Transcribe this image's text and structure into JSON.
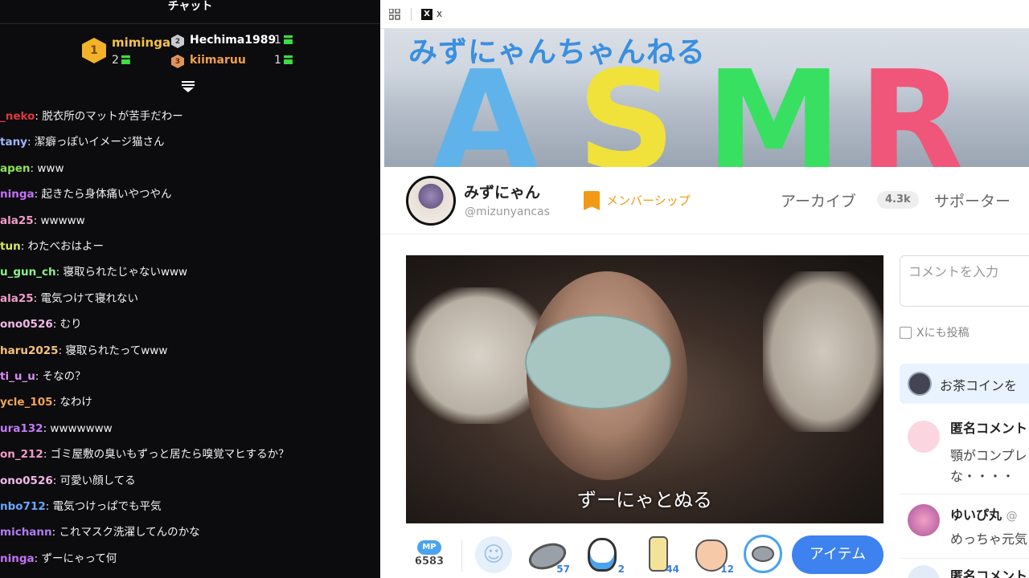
{
  "chat": {
    "title": "チャット",
    "ranking": [
      {
        "rank": "1",
        "name": "miminga",
        "count": "2",
        "name_color": "#f5c24a"
      },
      {
        "rank": "2",
        "name": "Hechima1989",
        "count": "1",
        "name_color": "#ffffff"
      },
      {
        "rank": "3",
        "name": "kiimaruu",
        "count": "1",
        "name_color": "#f0a04b"
      }
    ],
    "scroll_icon": "chevron-lines-down-icon",
    "messages": [
      {
        "user": "_neko",
        "text": "脱衣所のマットが苦手だわー",
        "color": "#e2363e"
      },
      {
        "user": "tany",
        "text": "潔癖っぽいイメージ猫さん",
        "color": "#9fb7ff"
      },
      {
        "user": "apen",
        "text": "www",
        "color": "#8ee25a"
      },
      {
        "user": "ninga",
        "text": "起きたら身体痛いやつやん",
        "color": "#c471f5"
      },
      {
        "user": "ala25",
        "text": "wwwww",
        "color": "#f29bc8"
      },
      {
        "user": "tun",
        "text": "わたべおはよー",
        "color": "#d6e85a"
      },
      {
        "user": "u_gun_ch",
        "text": "寝取られたじゃないwww",
        "color": "#8ef08a"
      },
      {
        "user": "ala25",
        "text": "電気つけて寝れない",
        "color": "#f29bc8"
      },
      {
        "user": "ono0526",
        "text": "むり",
        "color": "#f2b8e8"
      },
      {
        "user": "haru2025",
        "text": "寝取られたってwww",
        "color": "#f7c27a"
      },
      {
        "user": "ti_u_u",
        "text": "そなの？",
        "color": "#d98cf2"
      },
      {
        "user": "ycle_105",
        "text": "なわけ",
        "color": "#f2a45a"
      },
      {
        "user": "ura132",
        "text": "wwwwwww",
        "color": "#c27bf5"
      },
      {
        "user": "on_212",
        "text": "ゴミ屋敷の臭いもずっと居たら嗅覚マヒするか？",
        "color": "#f29bc8"
      },
      {
        "user": "ono0526",
        "text": "可愛い顔してる",
        "color": "#f2b8e8"
      },
      {
        "user": "nbo712",
        "text": "電気つけっぱでも平気",
        "color": "#6aa6ff"
      },
      {
        "user": "michann",
        "text": "これマスク洗濯してんのかな",
        "color": "#b07cf0"
      },
      {
        "user": "ninga",
        "text": "ずーにゃって何",
        "color": "#c471f5"
      }
    ]
  },
  "browser": {
    "apps_icon": "grid-icon",
    "tab_favicon": "x-logo-icon",
    "tab_label": "x"
  },
  "channel": {
    "banner_title": "みずにゃんちゃんねる",
    "banner_letters": "ASMR",
    "name": "みずにゃん",
    "handle": "@mizunyancas",
    "membership": "メンバーシップ",
    "archive": "アーカイブ",
    "archive_count": "4.3k",
    "supporter": "サポーター"
  },
  "video": {
    "caption": "ずーにゃとぬる"
  },
  "side": {
    "comment_placeholder": "コメントを入力",
    "x_share_label": "Xにも投稿",
    "tea_coin": "お茶コインを",
    "comments": [
      {
        "name": "匿名コメント",
        "lines": [
          "顎がコンプレ",
          "な・・・・"
        ]
      },
      {
        "name": "ゆいぴ丸",
        "handle": "@",
        "lines": [
          "めっちゃ元気"
        ]
      },
      {
        "name": "匿名コメント",
        "lines": []
      }
    ]
  },
  "toolbar": {
    "mp_label": "MP",
    "mp_value": "6583",
    "items": [
      {
        "icon": "smile-icon",
        "count": ""
      },
      {
        "icon": "coin-stone-icon",
        "count": "57"
      },
      {
        "icon": "penguin-icon",
        "count": "2"
      },
      {
        "icon": "drink-can-icon",
        "count": "44"
      },
      {
        "icon": "clap-icon",
        "count": "12"
      },
      {
        "icon": "coin-ring-icon",
        "count": ""
      }
    ],
    "item_button": "アイテム"
  }
}
